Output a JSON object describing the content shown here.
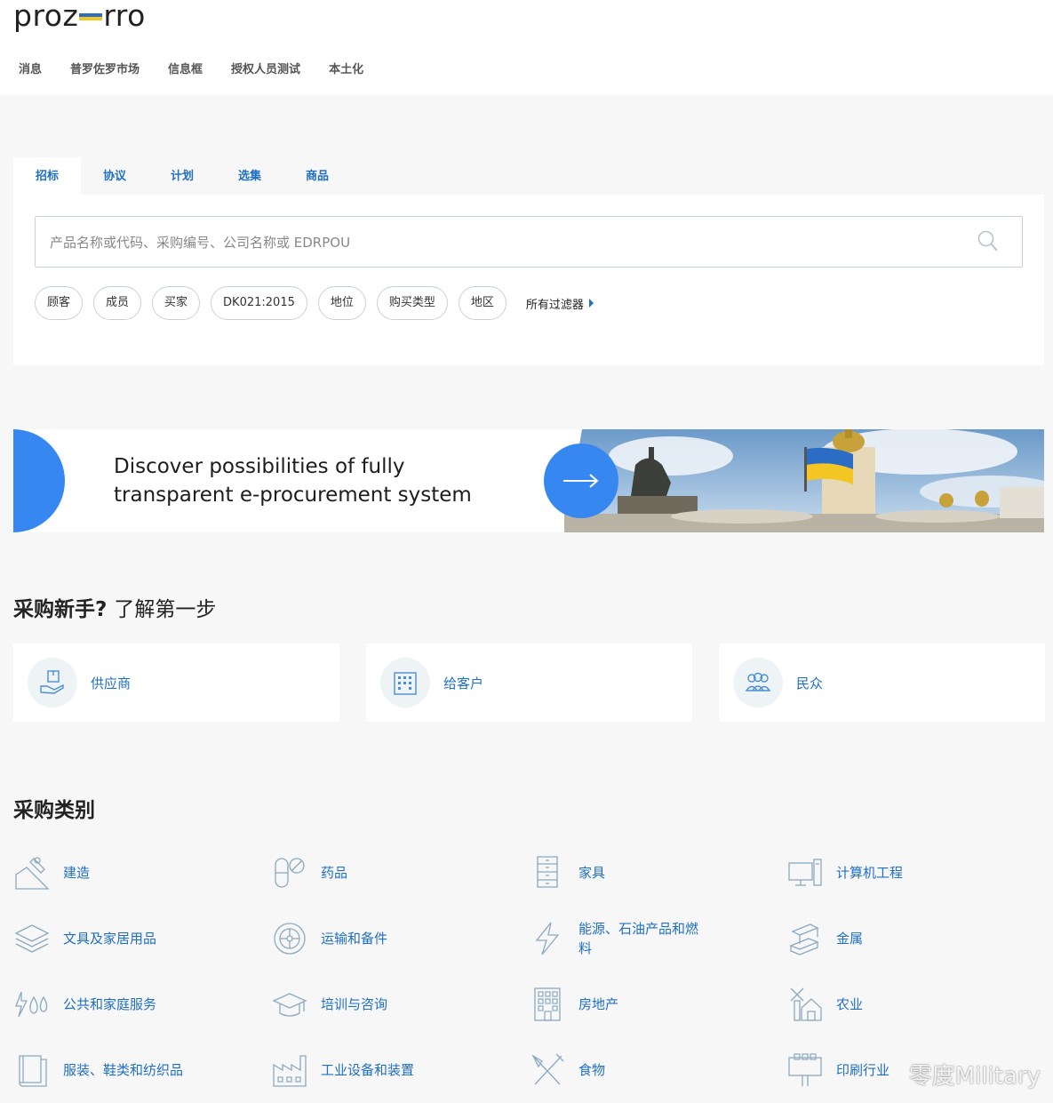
{
  "logo": {
    "left": "proz",
    "right": "rro",
    "flag_top": "#2b6cc4",
    "flag_bottom": "#f3c623"
  },
  "nav": [
    "消息",
    "普罗佐罗市场",
    "信息框",
    "授权人员测试",
    "本土化"
  ],
  "tabs": [
    "招标",
    "协议",
    "计划",
    "选集",
    "商品"
  ],
  "search": {
    "placeholder": "产品名称或代码、采购编号、公司名称或 EDRPOU"
  },
  "filters": [
    "顾客",
    "成员",
    "买家",
    "DK021:2015",
    "地位",
    "购买类型",
    "地区"
  ],
  "all_filters": "所有过滤器",
  "banner": {
    "line1": "Discover possibilities of fully",
    "line2": "transparent e-procurement system"
  },
  "newbie": {
    "title_bold": "采购新手?",
    "title_light": "了解第一步"
  },
  "cards": [
    "供应商",
    "给客户",
    "民众"
  ],
  "categories_title": "采购类别",
  "categories": [
    {
      "label": "建造",
      "icon": "construction-icon"
    },
    {
      "label": "药品",
      "icon": "pills-icon"
    },
    {
      "label": "家具",
      "icon": "furniture-icon"
    },
    {
      "label": "计算机工程",
      "icon": "computer-icon"
    },
    {
      "label": "文具及家居用品",
      "icon": "stationery-icon"
    },
    {
      "label": "运输和备件",
      "icon": "wheel-icon"
    },
    {
      "label": "能源、石油产品和燃料",
      "icon": "lightning-icon"
    },
    {
      "label": "金属",
      "icon": "metal-icon"
    },
    {
      "label": "公共和家庭服务",
      "icon": "utilities-icon"
    },
    {
      "label": "培训与咨询",
      "icon": "graduation-cap-icon"
    },
    {
      "label": "房地产",
      "icon": "building-icon"
    },
    {
      "label": "农业",
      "icon": "farm-icon"
    },
    {
      "label": "服装、鞋类和纺织品",
      "icon": "book-icon"
    },
    {
      "label": "工业设备和装置",
      "icon": "factory-icon"
    },
    {
      "label": "食物",
      "icon": "fork-knife-icon"
    },
    {
      "label": "印刷行业",
      "icon": "printing-icon"
    }
  ],
  "watermark": "零度Military"
}
